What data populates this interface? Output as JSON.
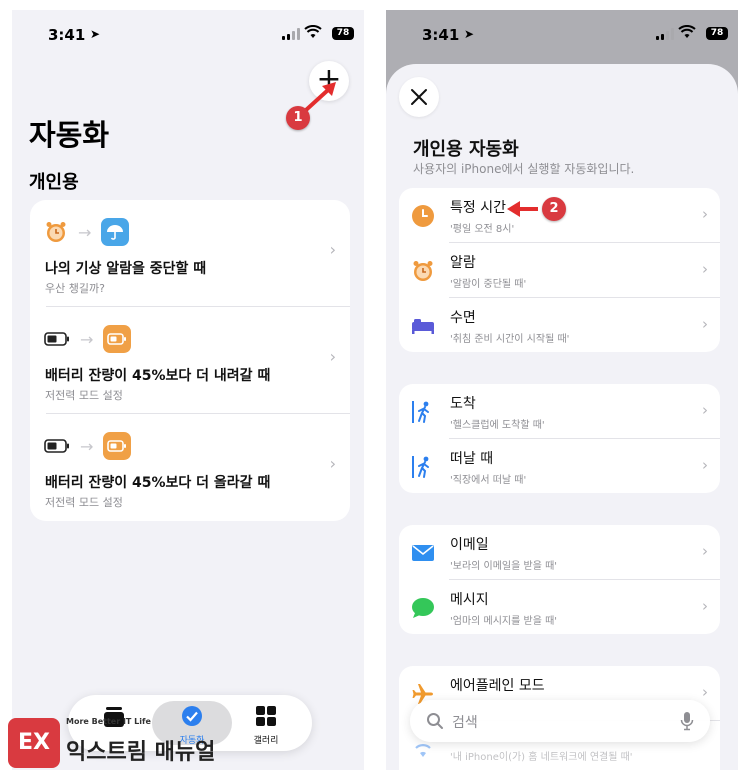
{
  "left": {
    "status": {
      "time": "3:41",
      "battery": "78"
    },
    "add_button": "+",
    "step_marker": "1",
    "title": "자동화",
    "section": "개인용",
    "automations": [
      {
        "name": "나의 기상 알람을 중단할 때",
        "subtitle": "우산 챙길까?"
      },
      {
        "name": "배터리 잔량이 45%보다 더 내려갈 때",
        "subtitle": "저전력 모드 설정"
      },
      {
        "name": "배터리 잔량이 45%보다 더 올라갈 때",
        "subtitle": "저전력 모드 설정"
      }
    ],
    "tabbar": {
      "automation_label": "자동화",
      "gallery_label": "갤러리"
    }
  },
  "watermark": {
    "logo": "EX",
    "tagline": "More Better IT Life",
    "name": "익스트림 매뉴얼"
  },
  "right": {
    "status": {
      "time": "3:41",
      "battery": "78"
    },
    "sheet_title": "개인용 자동화",
    "sheet_subtitle": "사용자의 iPhone에서 실행할 자동화입니다.",
    "step_marker": "2",
    "groups": [
      [
        {
          "name": "특정 시간",
          "subtitle": "'평일 오전 8시'",
          "icon": "clock-icon"
        },
        {
          "name": "알람",
          "subtitle": "'알람이 중단될 때'",
          "icon": "alarm-clock-icon"
        },
        {
          "name": "수면",
          "subtitle": "'취침 준비 시간이 시작될 때'",
          "icon": "bed-icon"
        }
      ],
      [
        {
          "name": "도착",
          "subtitle": "'헬스클럽에 도착할 때'",
          "icon": "walk-arrive-icon"
        },
        {
          "name": "떠날 때",
          "subtitle": "'직장에서 떠날 때'",
          "icon": "walk-leave-icon"
        }
      ],
      [
        {
          "name": "이메일",
          "subtitle": "'보라의 이메일을 받을 때'",
          "icon": "mail-icon"
        },
        {
          "name": "메시지",
          "subtitle": "'엄마의 메시지를 받을 때'",
          "icon": "message-icon"
        }
      ],
      [
        {
          "name": "에어플레인 모드",
          "subtitle": "",
          "icon": "airplane-icon"
        }
      ]
    ],
    "partial_row_text": "'내 iPhone이(가) 홈 네트워크에 연결될 때'",
    "search_placeholder": "검색"
  },
  "colors": {
    "accent_blue": "#2c7fee",
    "marker_red": "#d93a40",
    "orange": "#f0a046"
  }
}
